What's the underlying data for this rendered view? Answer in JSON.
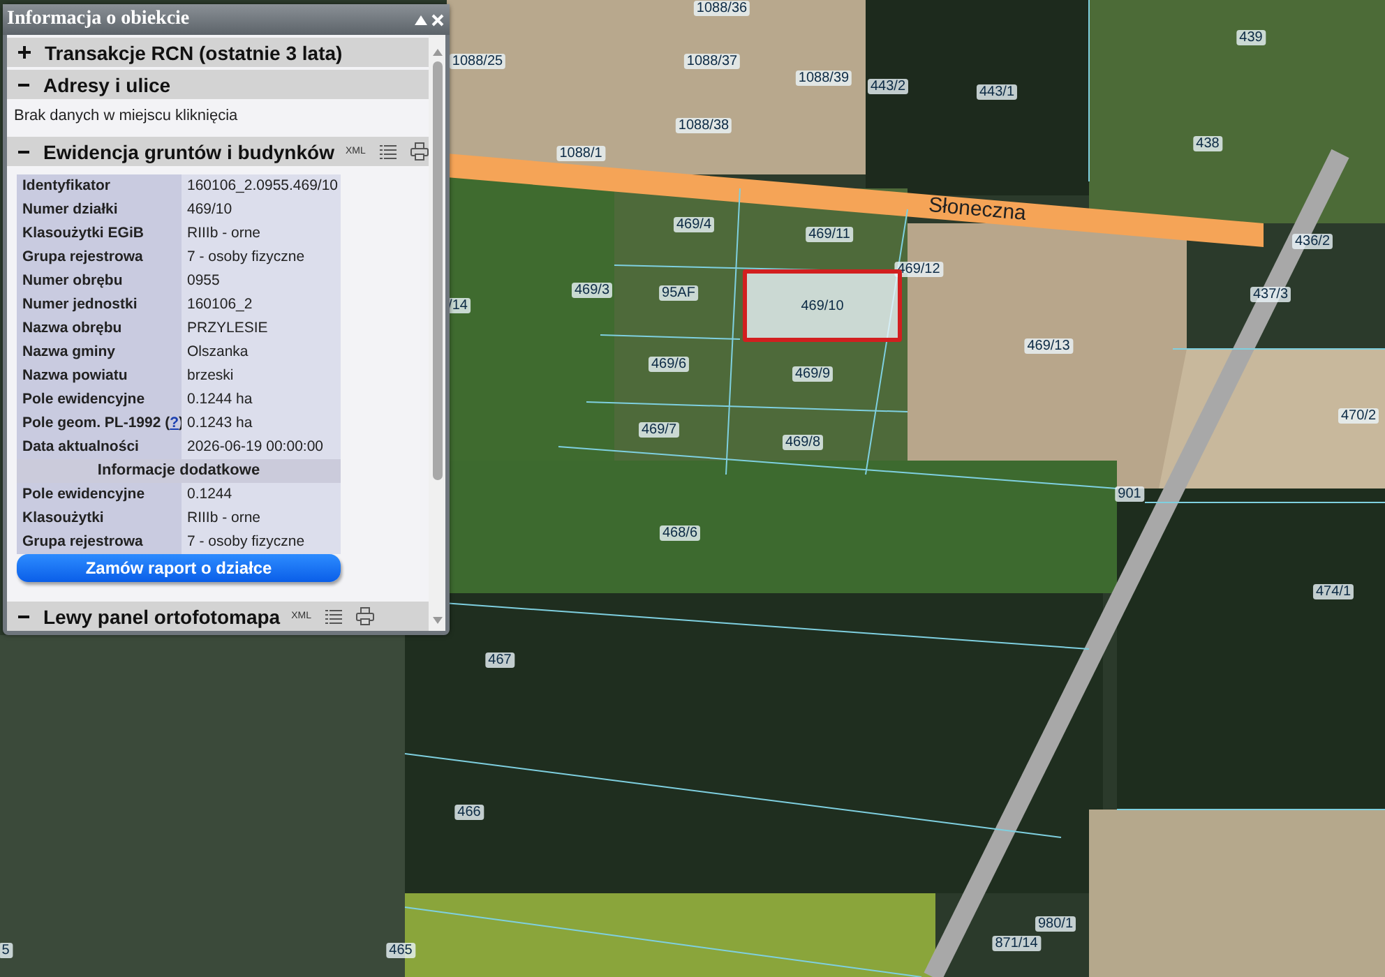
{
  "map": {
    "street": "Słoneczna",
    "parcels": [
      {
        "label": "1088/36",
        "selected": false
      },
      {
        "label": "1088/25",
        "selected": false
      },
      {
        "label": "1088/37",
        "selected": false
      },
      {
        "label": "1088/39",
        "selected": false
      },
      {
        "label": "443/2",
        "selected": false
      },
      {
        "label": "443/1",
        "selected": false
      },
      {
        "label": "439",
        "selected": false
      },
      {
        "label": "1088/38",
        "selected": false
      },
      {
        "label": "1088/1",
        "selected": false
      },
      {
        "label": "438",
        "selected": false
      },
      {
        "label": "469/4",
        "selected": false
      },
      {
        "label": "469/11",
        "selected": false
      },
      {
        "label": "469/12",
        "selected": false
      },
      {
        "label": "436/2",
        "selected": false
      },
      {
        "label": "469/3",
        "selected": false
      },
      {
        "label": "95AF",
        "selected": false
      },
      {
        "label": "/14",
        "selected": false
      },
      {
        "label": "469/10",
        "selected": true
      },
      {
        "label": "437/3",
        "selected": false
      },
      {
        "label": "469/13",
        "selected": false
      },
      {
        "label": "469/6",
        "selected": false
      },
      {
        "label": "469/9",
        "selected": false
      },
      {
        "label": "470/2",
        "selected": false
      },
      {
        "label": "469/7",
        "selected": false
      },
      {
        "label": "469/8",
        "selected": false
      },
      {
        "label": "901",
        "selected": false
      },
      {
        "label": "468/6",
        "selected": false
      },
      {
        "label": "474/1",
        "selected": false
      },
      {
        "label": "467",
        "selected": false
      },
      {
        "label": "466",
        "selected": false
      },
      {
        "label": "980/1",
        "selected": false
      },
      {
        "label": "871/14",
        "selected": false
      },
      {
        "label": "465",
        "selected": false
      },
      {
        "label": "5",
        "selected": false
      }
    ]
  },
  "window": {
    "title": "Informacja o obiekcie"
  },
  "sections": [
    {
      "title": "Transakcje RCN (ostatnie 3 lata)",
      "expanded": false
    },
    {
      "title": "Adresy i ulice",
      "expanded": true,
      "message": "Brak danych w miejscu kliknięcia"
    },
    {
      "title": "Ewidencja gruntów i budynków",
      "expanded": true,
      "xml": "XML",
      "rows": [
        {
          "kind": "row",
          "label": "Identyfikator",
          "value": "160106_2.0955.469/10"
        },
        {
          "kind": "row",
          "label": "Numer działki",
          "value": "469/10"
        },
        {
          "kind": "row",
          "label": "Klasoużytki EGiB",
          "value": "RIIIb - orne"
        },
        {
          "kind": "row",
          "label": "Grupa rejestrowa",
          "value": "7 - osoby fizyczne"
        },
        {
          "kind": "row",
          "label": "Numer obrębu",
          "value": "0955"
        },
        {
          "kind": "row",
          "label": "Numer jednostki",
          "value": "160106_2"
        },
        {
          "kind": "row",
          "label": "Nazwa obrębu",
          "value": "PRZYLESIE"
        },
        {
          "kind": "row",
          "label": "Nazwa gminy",
          "value": "Olszanka"
        },
        {
          "kind": "row",
          "label": "Nazwa powiatu",
          "value": "brzeski"
        },
        {
          "kind": "row",
          "label": "Pole ewidencyjne",
          "value": "0.1244 ha"
        },
        {
          "kind": "row",
          "label": "Pole geom. PL-1992 (",
          "link": "?",
          "label_end": ")",
          "value": "0.1243 ha"
        },
        {
          "kind": "row",
          "label": "Data aktualności",
          "value": "2026-06-19 00:00:00"
        },
        {
          "kind": "header",
          "label": "Informacje dodatkowe"
        },
        {
          "kind": "row",
          "label": "Pole ewidencyjne",
          "value": "0.1244"
        },
        {
          "kind": "row",
          "label": "Klasoużytki",
          "value": "RIIIb - orne"
        },
        {
          "kind": "row",
          "label": "Grupa rejestrowa",
          "value": "7 - osoby fizyczne"
        }
      ],
      "button": "Zamów raport o działce"
    },
    {
      "title": "Lewy panel ortofotomapa",
      "expanded": true,
      "xml": "XML"
    }
  ]
}
